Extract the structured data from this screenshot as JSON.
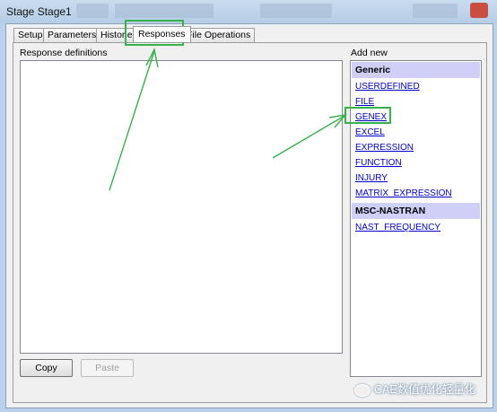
{
  "window": {
    "title": "Stage Stage1"
  },
  "tabs": [
    {
      "label": "Setup"
    },
    {
      "label": "Parameters"
    },
    {
      "label": "Histories"
    },
    {
      "label": "Responses"
    },
    {
      "label": "File Operations"
    }
  ],
  "responses": {
    "definitions_label": "Response definitions",
    "copy_label": "Copy",
    "paste_label": "Paste"
  },
  "add_new": {
    "label": "Add new",
    "groups": [
      {
        "name": "Generic",
        "items": [
          "USERDEFINED",
          "FILE",
          "GENEX",
          "EXCEL",
          "EXPRESSION",
          "FUNCTION",
          "INJURY",
          "MATRIX_EXPRESSION"
        ]
      },
      {
        "name": "MSC-NASTRAN",
        "items": [
          "NAST_FREQUENCY"
        ]
      }
    ]
  },
  "watermark": {
    "text": "CAE数值优化轻量化"
  },
  "colors": {
    "highlight": "#37b24a",
    "link": "#0000cc",
    "group_header": "#cfcff8"
  }
}
